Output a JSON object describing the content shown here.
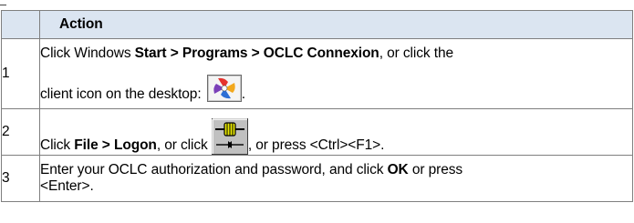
{
  "table": {
    "header": {
      "num": "",
      "action": "Action"
    },
    "rows": [
      {
        "num": "1",
        "t1": "Click Windows ",
        "t2": "Start > Programs > OCLC Connexion",
        "t3": ", or click the",
        "t4": "client icon on the desktop: ",
        "t5": "."
      },
      {
        "num": "2",
        "t1": "Click  ",
        "t2": "File > Logon",
        "t3": ", or click ",
        "t4": ", or press <Ctrl><F1>."
      },
      {
        "num": "3",
        "t1": "Enter your OCLC authorization and password, and click ",
        "t2": "OK",
        "t3": " or press",
        "t4": "<Enter>."
      }
    ]
  },
  "icons": {
    "client": "oclc-connexion-client-icon",
    "logon": "logon-connect-icon"
  }
}
